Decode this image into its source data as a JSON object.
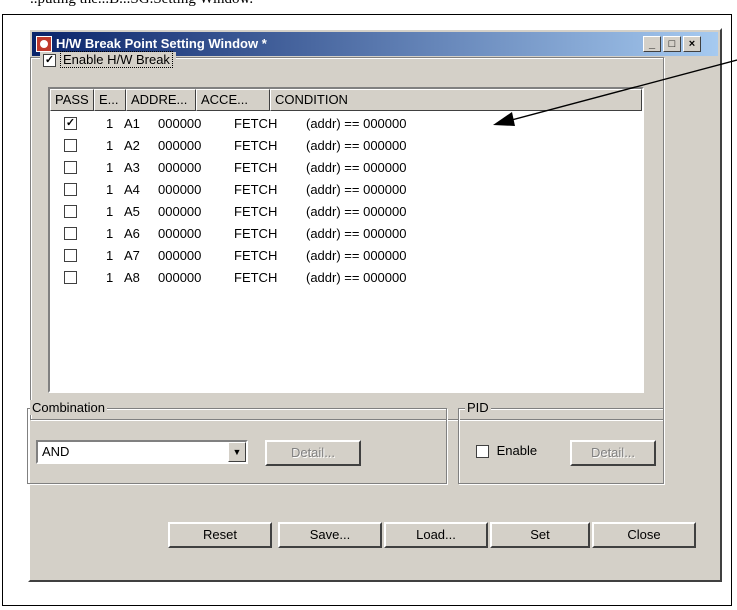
{
  "caption_fragment": "..puting the...B...SG.Setting Window.",
  "window": {
    "title": "H/W Break Point Setting Window *",
    "min_glyph": "_",
    "max_glyph": "□",
    "close_glyph": "×"
  },
  "enable_hw_break": {
    "checked": true,
    "label": "Enable H/W Break"
  },
  "list": {
    "columns": [
      "PASS",
      "E...",
      "ADDRE...",
      "ACCE...",
      "CONDITION"
    ],
    "rows": [
      {
        "checked": true,
        "pass": "1",
        "entry": "A1",
        "address": "000000",
        "access": "FETCH",
        "condition": "(addr) == 000000"
      },
      {
        "checked": false,
        "pass": "1",
        "entry": "A2",
        "address": "000000",
        "access": "FETCH",
        "condition": "(addr) == 000000"
      },
      {
        "checked": false,
        "pass": "1",
        "entry": "A3",
        "address": "000000",
        "access": "FETCH",
        "condition": "(addr) == 000000"
      },
      {
        "checked": false,
        "pass": "1",
        "entry": "A4",
        "address": "000000",
        "access": "FETCH",
        "condition": "(addr) == 000000"
      },
      {
        "checked": false,
        "pass": "1",
        "entry": "A5",
        "address": "000000",
        "access": "FETCH",
        "condition": "(addr) == 000000"
      },
      {
        "checked": false,
        "pass": "1",
        "entry": "A6",
        "address": "000000",
        "access": "FETCH",
        "condition": "(addr) == 000000"
      },
      {
        "checked": false,
        "pass": "1",
        "entry": "A7",
        "address": "000000",
        "access": "FETCH",
        "condition": "(addr) == 000000"
      },
      {
        "checked": false,
        "pass": "1",
        "entry": "A8",
        "address": "000000",
        "access": "FETCH",
        "condition": "(addr) == 000000"
      }
    ]
  },
  "combination": {
    "label": "Combination",
    "value": "AND",
    "detail_label": "Detail..."
  },
  "pid": {
    "label": "PID",
    "enable_label": "Enable",
    "enable_checked": false,
    "detail_label": "Detail..."
  },
  "buttons": {
    "reset": "Reset",
    "save": "Save...",
    "load": "Load...",
    "set": "Set",
    "close": "Close"
  },
  "colors": {
    "title_start": "#0a246a",
    "title_end": "#a6caf0",
    "face": "#d4d0c8"
  }
}
